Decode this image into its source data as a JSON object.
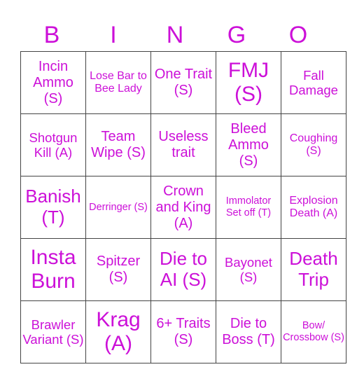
{
  "header": {
    "letters": [
      "B",
      "I",
      "N",
      "G",
      "O"
    ]
  },
  "board": {
    "rows": [
      [
        "Incin Ammo (S)",
        "Lose Bar to Bee Lady",
        "One Trait (S)",
        "FMJ (S)",
        "Fall Damage"
      ],
      [
        "Shotgun Kill (A)",
        "Team Wipe (S)",
        "Useless trait",
        "Bleed Ammo (S)",
        "Coughing (S)"
      ],
      [
        "Banish (T)",
        "Derringer (S)",
        "Crown and King (A)",
        "Immolator Set off (T)",
        "Explosion Death (A)"
      ],
      [
        "Insta Burn",
        "Spitzer (S)",
        "Die to AI (S)",
        "Bayonet (S)",
        "Death Trip"
      ],
      [
        "Brawler Variant (S)",
        "Krag (A)",
        "6+ Traits (S)",
        "Die to Boss (T)",
        "Bow/ Crossbow (S)"
      ]
    ]
  },
  "colors": {
    "text": "#cc10d8",
    "grid": "#444444",
    "background": "#ffffff"
  }
}
